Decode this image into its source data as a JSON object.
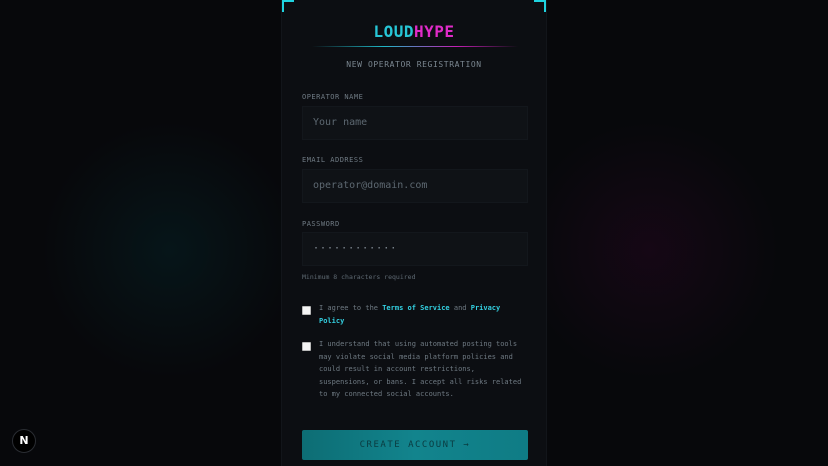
{
  "brand": {
    "part1": "LOUD",
    "part2": "HYPE"
  },
  "subtitle": "NEW OPERATOR REGISTRATION",
  "fields": {
    "name": {
      "label": "OPERATOR NAME",
      "placeholder": "Your name"
    },
    "email": {
      "label": "EMAIL ADDRESS",
      "placeholder": "operator@domain.com"
    },
    "password": {
      "label": "PASSWORD",
      "value": "············"
    }
  },
  "password_hint": "Minimum 8 characters required",
  "terms": {
    "prefix": "I agree to the ",
    "terms_link": "Terms of Service",
    "middle": " and ",
    "privacy_link": "Privacy Policy"
  },
  "risk_text": "I understand that using automated posting tools may violate social media platform policies and could result in account restrictions, suspensions, or bans. I accept all risks related to my connected social accounts.",
  "create_button": "CREATE ACCOUNT →",
  "next_badge": "N",
  "colors": {
    "accent_cyan": "#27c6d6",
    "accent_magenta": "#e02bc8",
    "background": "#07080b"
  }
}
